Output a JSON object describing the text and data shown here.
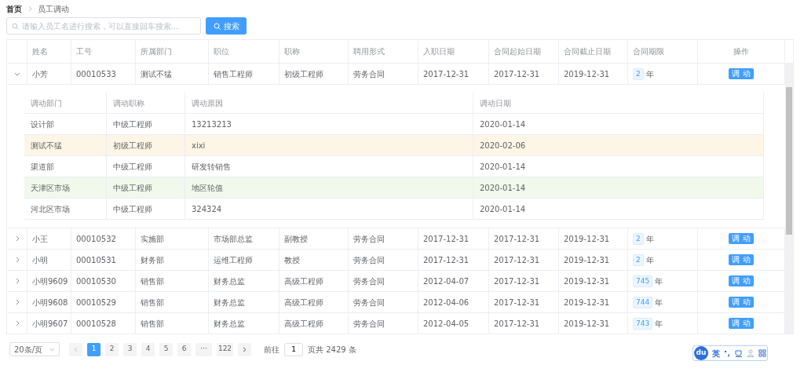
{
  "breadcrumb": [
    "首页",
    "员工调动"
  ],
  "search": {
    "placeholder": "请输入员工名进行搜索，可以直接回车搜索...",
    "button": "搜索"
  },
  "table": {
    "columns": [
      "姓名",
      "工号",
      "所属部门",
      "职位",
      "职称",
      "聘用形式",
      "入职日期",
      "合同起始日期",
      "合同截止日期",
      "合同期限",
      "操作"
    ],
    "rows": [
      {
        "expanded": true,
        "cells": [
          "小芳",
          "00010533",
          "测试不猛",
          "销售工程师",
          "初级工程师",
          "劳务合同",
          "2017-12-31",
          "2017-12-31",
          "2019-12-31"
        ],
        "term": "2",
        "unit": "年",
        "action": "调 动",
        "detail": {
          "columns": [
            "调动部门",
            "调动职称",
            "调动原因",
            "调动日期"
          ],
          "rows": [
            {
              "color": "#ffffff",
              "cells": [
                "设计部",
                "中级工程师",
                "13213213",
                "2020-01-14"
              ]
            },
            {
              "color": "#fdf5e6",
              "cells": [
                "测试不猛",
                "初级工程师",
                "xixi",
                "2020-02-06"
              ]
            },
            {
              "color": "#ffffff",
              "cells": [
                "渠道部",
                "中级工程师",
                "研发转销售",
                "2020-01-14"
              ]
            },
            {
              "color": "#f0f9eb",
              "cells": [
                "天津区市场",
                "中级工程师",
                "地区轮值",
                "2020-01-14"
              ]
            },
            {
              "color": "#ffffff",
              "cells": [
                "河北区市场",
                "中级工程师",
                "324324",
                "2020-01-14"
              ]
            }
          ]
        }
      },
      {
        "expanded": false,
        "cells": [
          "小王",
          "00010532",
          "实施部",
          "市场部总监",
          "副教授",
          "劳务合同",
          "2017-12-31",
          "2017-12-31",
          "2019-12-31"
        ],
        "term": "2",
        "unit": "年",
        "action": "调 动"
      },
      {
        "expanded": false,
        "cells": [
          "小明",
          "00010531",
          "财务部",
          "运维工程师",
          "教授",
          "劳务合同",
          "2017-12-31",
          "2017-12-31",
          "2019-12-31"
        ],
        "term": "2",
        "unit": "年",
        "action": "调 动"
      },
      {
        "expanded": false,
        "cells": [
          "小明9609",
          "00010530",
          "销售部",
          "财务总监",
          "高级工程师",
          "劳务合同",
          "2012-04-07",
          "2017-12-31",
          "2019-12-31"
        ],
        "term": "745",
        "unit": "年",
        "action": "调 动"
      },
      {
        "expanded": false,
        "cells": [
          "小明9608",
          "00010529",
          "销售部",
          "财务总监",
          "高级工程师",
          "劳务合同",
          "2012-04-06",
          "2017-12-31",
          "2019-12-31"
        ],
        "term": "744",
        "unit": "年",
        "action": "调 动"
      },
      {
        "expanded": false,
        "cells": [
          "小明9607",
          "00010528",
          "销售部",
          "财务总监",
          "高级工程师",
          "劳务合同",
          "2012-04-05",
          "2017-12-31",
          "2019-12-31"
        ],
        "term": "743",
        "unit": "年",
        "action": "调 动"
      }
    ]
  },
  "pagination": {
    "page_size": "20条/页",
    "pages": [
      {
        "label": "1",
        "selected": true
      },
      {
        "label": "2",
        "selected": false
      },
      {
        "label": "3",
        "selected": false
      },
      {
        "label": "4",
        "selected": false
      },
      {
        "label": "5",
        "selected": false
      },
      {
        "label": "6",
        "selected": false
      },
      {
        "label": "···",
        "selected": false
      },
      {
        "label": "122",
        "selected": false
      }
    ],
    "goto_label": "前往",
    "goto_value": "1",
    "total": "页共 2429 条"
  },
  "ime_bar": {
    "logo": "du",
    "mode": "英"
  }
}
